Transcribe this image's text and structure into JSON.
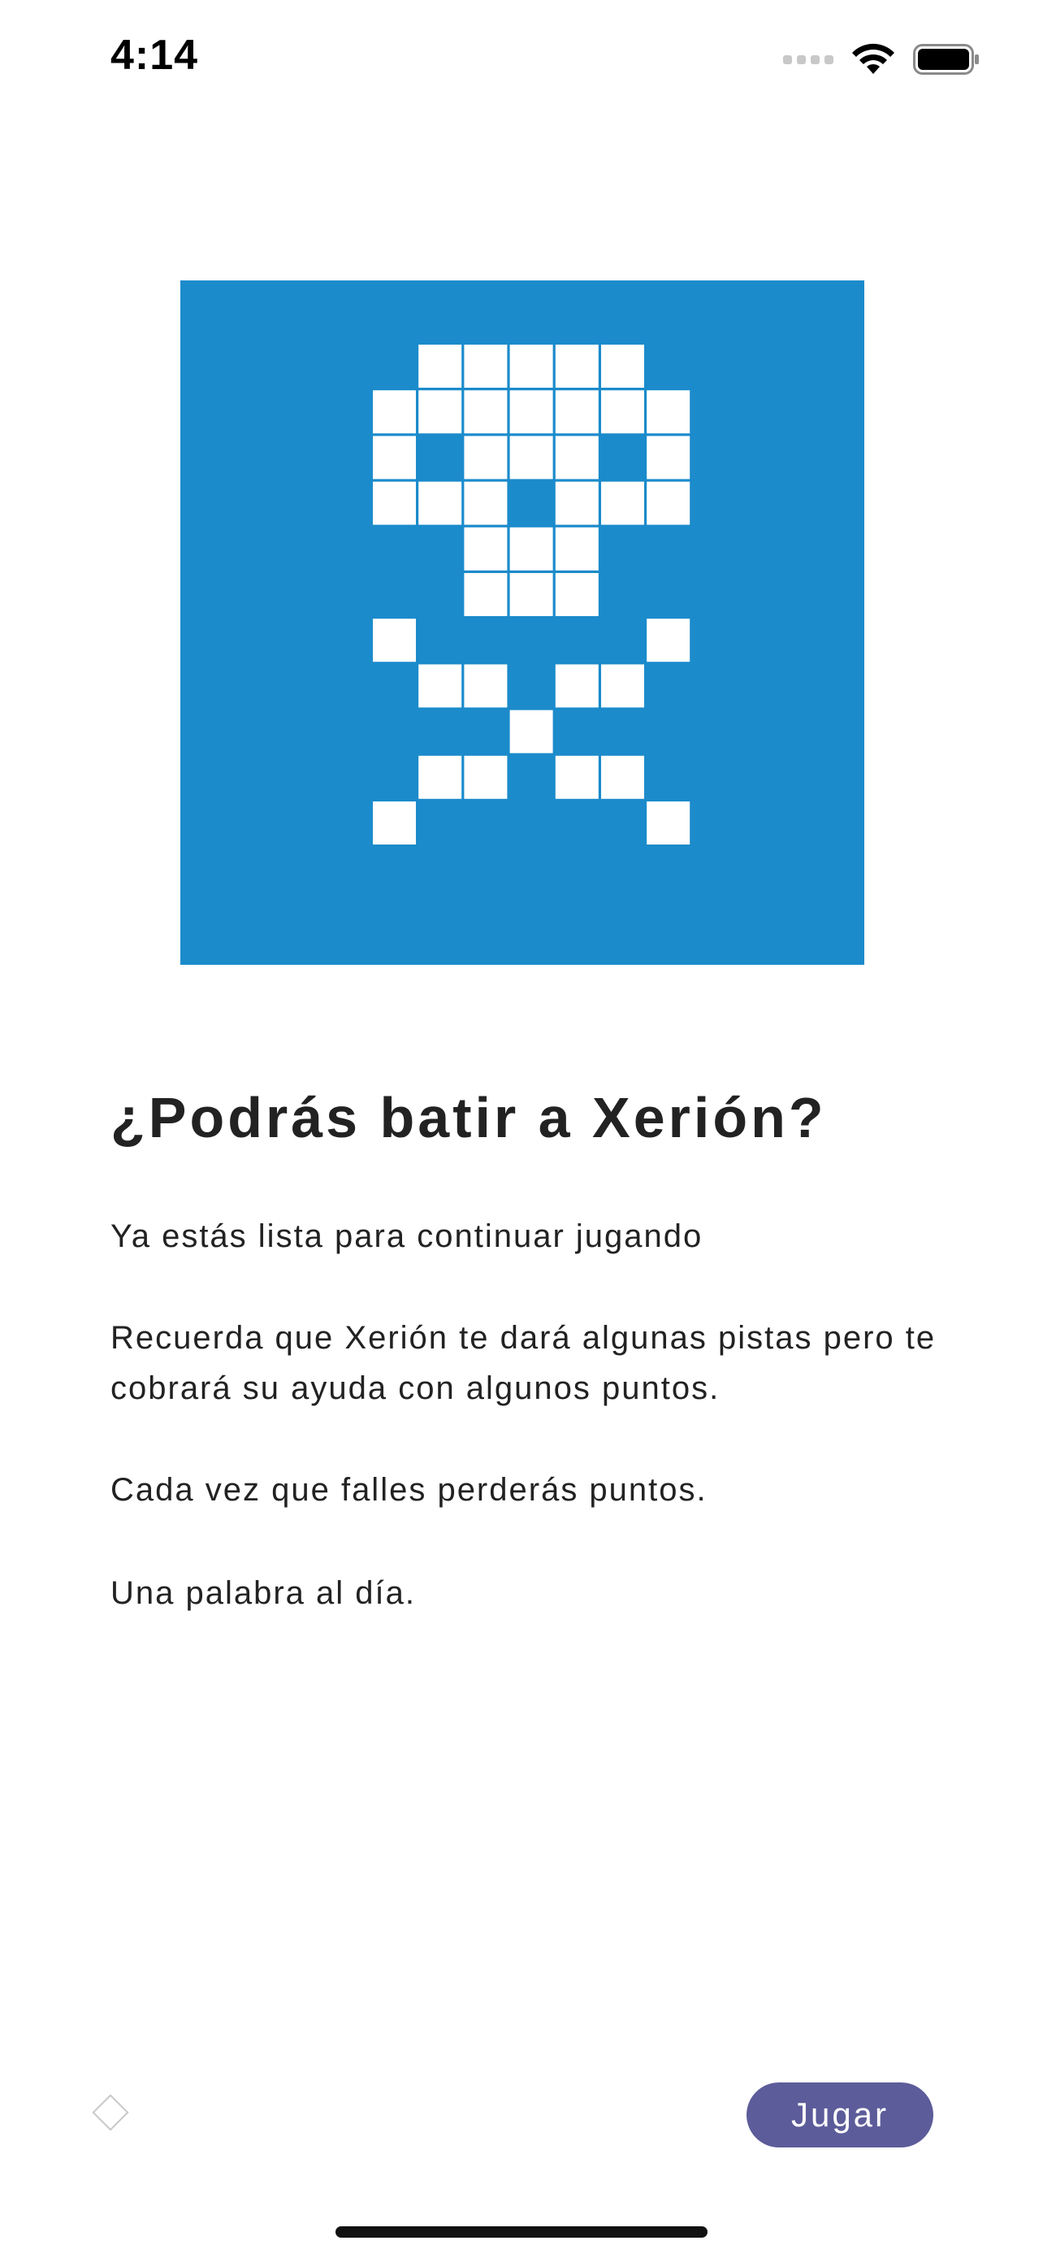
{
  "status_bar": {
    "time": "4:14",
    "icons": [
      "cellular-signal-icon",
      "wifi-icon",
      "battery-icon"
    ]
  },
  "hero_image": {
    "icon": "pixel-skull-crossbones-icon",
    "background_color": "#1b8bcb",
    "pixel_color": "#ffffff"
  },
  "intro": {
    "title": "¿Podrás batir a Xerión?",
    "paragraphs": [
      "Ya estás lista para continuar jugando",
      "Recuerda que Xerión te dará algunas pistas pero te cobrará su ayuda con algunos puntos.",
      "Cada vez que falles perderás puntos.",
      "Una palabra al día."
    ]
  },
  "footer": {
    "diamond_icon": "diamond-outline-icon",
    "play_label": "Jugar",
    "play_color": "#5c5c9a"
  }
}
